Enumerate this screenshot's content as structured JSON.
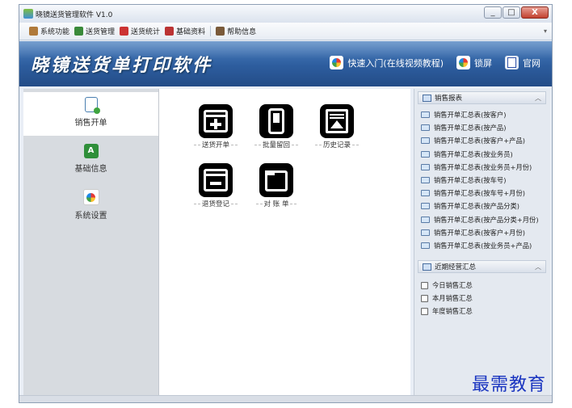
{
  "window": {
    "title": "晓镜送货管理软件 V1.0",
    "buttons": [
      "_",
      "□",
      "X"
    ]
  },
  "toolbar": {
    "items": [
      {
        "label": "系统功能",
        "icon": "system-icon",
        "color": "#b07a3a"
      },
      {
        "label": "送货管理",
        "icon": "delivery-icon",
        "color": "#3a8a3a"
      },
      {
        "label": "送货统计",
        "icon": "stats-icon",
        "color": "#c33"
      },
      {
        "label": "基础资料",
        "icon": "tools-icon",
        "color": "#b33"
      },
      {
        "label": "帮助信息",
        "icon": "help-icon",
        "color": "#7a5a3a"
      }
    ]
  },
  "banner": {
    "title": "晓镜送货单打印软件",
    "links": [
      {
        "label": "快速入门(在线视频教程)",
        "icon": "color-swirl-icon"
      },
      {
        "label": "锁屏",
        "icon": "lock-screen-icon"
      },
      {
        "label": "官网",
        "icon": "website-icon"
      }
    ]
  },
  "leftnav": [
    {
      "label": "销售开单",
      "icon": "new-document-icon",
      "active": true
    },
    {
      "label": "基础信息",
      "icon": "basic-info-icon",
      "active": false
    },
    {
      "label": "系统设置",
      "icon": "color-swirl-icon",
      "active": false
    }
  ],
  "tiles": [
    {
      "label": "送货开单",
      "icon": "add-order-icon"
    },
    {
      "label": "批量留回",
      "icon": "batch-return-icon"
    },
    {
      "label": "历史记录",
      "icon": "history-icon"
    },
    {
      "label": "退货登记",
      "icon": "return-register-icon"
    },
    {
      "label": "对 账 单",
      "icon": "statement-folder-icon"
    }
  ],
  "sales_reports": {
    "header": "销售报表",
    "items": [
      "销售开单汇总表(按客户)",
      "销售开单汇总表(按产品)",
      "销售开单汇总表(按客户+产品)",
      "销售开单汇总表(按业务员)",
      "销售开单汇总表(按业务员+月份)",
      "销售开单汇总表(按车号)",
      "销售开单汇总表(按车号+月份)",
      "销售开单汇总表(按产品分类)",
      "销售开单汇总表(按产品分类+月份)",
      "销售开单汇总表(按客户+月份)",
      "销售开单汇总表(按业务员+产品)"
    ]
  },
  "recent_summary": {
    "header": "近期经营汇总",
    "items": [
      "今日销售汇总",
      "本月销售汇总",
      "年度销售汇总"
    ]
  },
  "watermark": "最需教育"
}
